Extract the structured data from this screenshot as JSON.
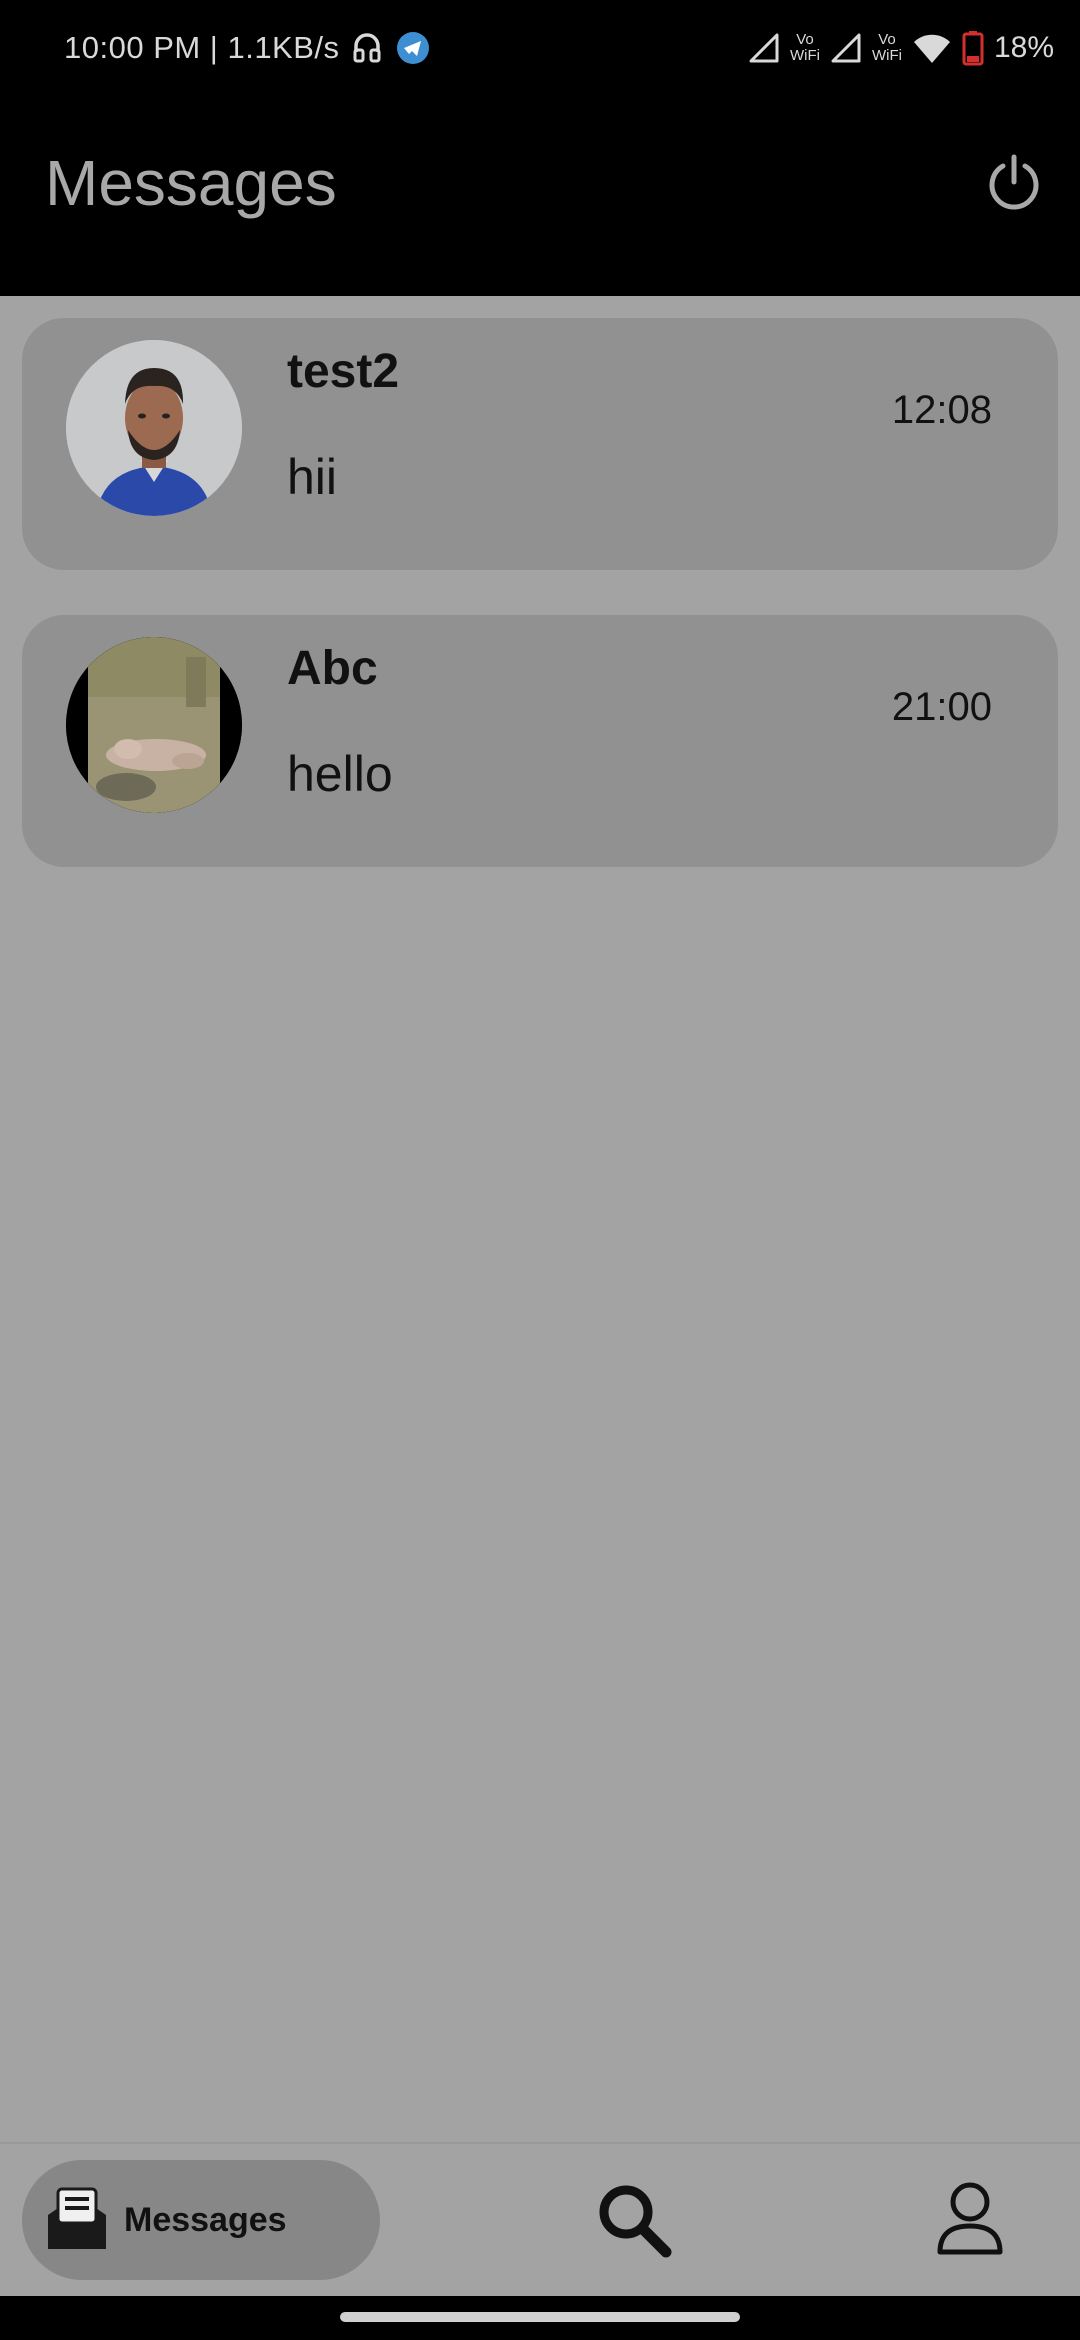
{
  "status_bar": {
    "time_speed": "10:00 PM | 1.1KB/s",
    "vo_label": "Vo",
    "wifi_label": "WiFi",
    "battery": "18%"
  },
  "header": {
    "title": "Messages"
  },
  "conversations": [
    {
      "name": "test2",
      "last_message": "hii",
      "time": "12:08"
    },
    {
      "name": "Abc",
      "last_message": "hello",
      "time": "21:00"
    }
  ],
  "bottom_nav": {
    "messages_label": "Messages"
  },
  "colors": {
    "background": "#a3a3a3",
    "card": "#919191",
    "header": "#000000",
    "active_nav": "#878787",
    "battery": "#d32f2f"
  }
}
